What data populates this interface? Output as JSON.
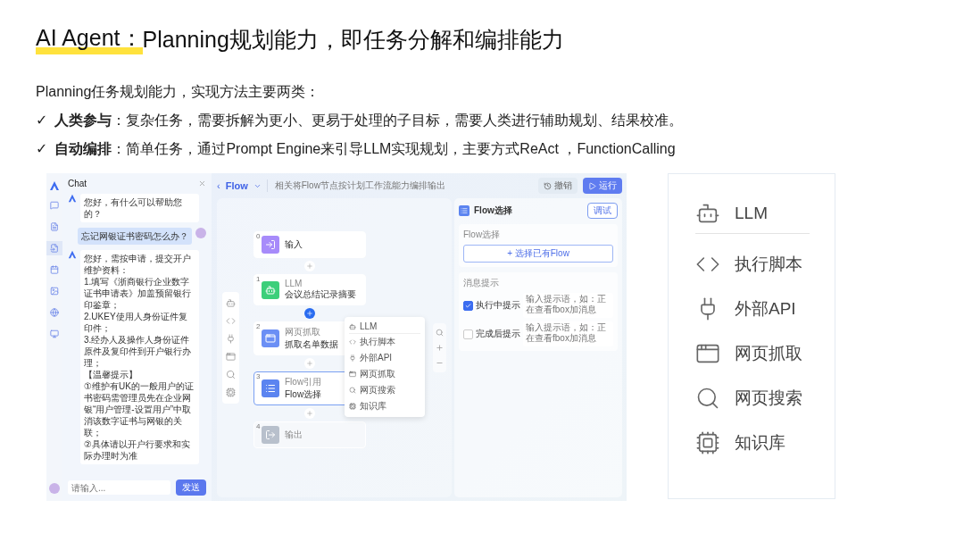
{
  "title": {
    "highlight": "AI Agent：",
    "rest": "Planning规划能力，即任务分解和编排能力"
  },
  "intro": "Planning任务规划能力，实现方法主要两类：",
  "bullets": [
    {
      "mark": "✓",
      "text": "**人类参与**：复杂任务，需要拆解为更小、更易于处理的子目标，需要人类进行辅助规划、结果校准。"
    },
    {
      "mark": "✓",
      "text": "**自动编排**：简单任务，通过Prompt Engine来引导LLM实现规划，主要方式ReAct ，FunctionCalling"
    }
  ],
  "app": {
    "nav": [
      {
        "selected": false
      },
      {
        "selected": false
      },
      {
        "selected": true
      },
      {
        "selected": false
      },
      {
        "selected": false
      },
      {
        "selected": false
      },
      {
        "selected": false
      }
    ],
    "chat": {
      "title": "Chat",
      "messages": [
        {
          "kind": "bot",
          "text": "您好，有什么可以帮助您的？"
        },
        {
          "kind": "user",
          "text": "忘记网银证书密码怎么办？"
        },
        {
          "kind": "bot",
          "lines": [
            "您好，需按申请，提交开户维护资料：",
            "1.填写《浙商银行企业数字证书申请表》加盖预留银行印鉴章；",
            "2.UKEY使用人身份证件复印件；",
            "3.经办人及操作人身份证件原件及复印件到开户银行办理；",
            "【温馨提示】",
            "①维护有UK的一般用户的证书密码需管理员先在企业网银“用户管理-设置用户”中取消该数字证书与网银的关联；",
            "②具体请以开户行要求和实际办理时为准"
          ]
        }
      ],
      "input_placeholder": "请输入...",
      "send": "发送"
    },
    "flow": {
      "back": "‹",
      "name": "Flow",
      "description": "相关将Flow节点按计划工作流能力编排输出",
      "undo": "撤销",
      "run": "运行",
      "nodes": [
        {
          "index": "0",
          "kind": "input",
          "name": "输入",
          "selected": false,
          "disabled": false
        },
        {
          "index": "1",
          "kind": "llm",
          "category": "LLM",
          "name": "会议总结记录摘要",
          "selected": false,
          "disabled": false
        },
        {
          "index": "2",
          "kind": "crawl",
          "category": "网页抓取",
          "name": "抓取名单数据",
          "selected": false,
          "disabled": false
        },
        {
          "index": "3",
          "kind": "flow",
          "category": "Flow引用",
          "name": "Flow选择",
          "selected": true,
          "disabled": false
        },
        {
          "index": "4",
          "kind": "output",
          "name": "输出",
          "selected": false,
          "disabled": true
        }
      ],
      "connectors": [
        {
          "active": false
        },
        {
          "active": true
        },
        {
          "active": false
        },
        {
          "active": false
        }
      ],
      "menu": [
        {
          "kind": "llm",
          "label": "LLM"
        },
        {
          "kind": "script",
          "label": "执行脚本"
        },
        {
          "kind": "api",
          "label": "外部API"
        },
        {
          "kind": "crawl",
          "label": "网页抓取"
        },
        {
          "kind": "search",
          "label": "网页搜索"
        },
        {
          "kind": "kb",
          "label": "知识库"
        }
      ],
      "panel": {
        "title": "Flow选择",
        "debug": "调试",
        "select_label": "Flow选择",
        "select_button": "+ 选择已有Flow",
        "hint_label": "消息提示",
        "hints": [
          {
            "label": "执行中提示",
            "checked": true,
            "placeholder": "输入提示语，如：正在查看fbox加消息"
          },
          {
            "label": "完成后提示",
            "checked": false,
            "placeholder": "输入提示语，如：正在查看fbox加消息"
          }
        ]
      }
    }
  },
  "tool_card": [
    {
      "kind": "llm",
      "label": "LLM"
    },
    {
      "kind": "script",
      "label": "执行脚本"
    },
    {
      "kind": "api",
      "label": "外部API"
    },
    {
      "kind": "crawl",
      "label": "网页抓取"
    },
    {
      "kind": "search",
      "label": "网页搜索"
    },
    {
      "kind": "kb",
      "label": "知识库"
    }
  ]
}
